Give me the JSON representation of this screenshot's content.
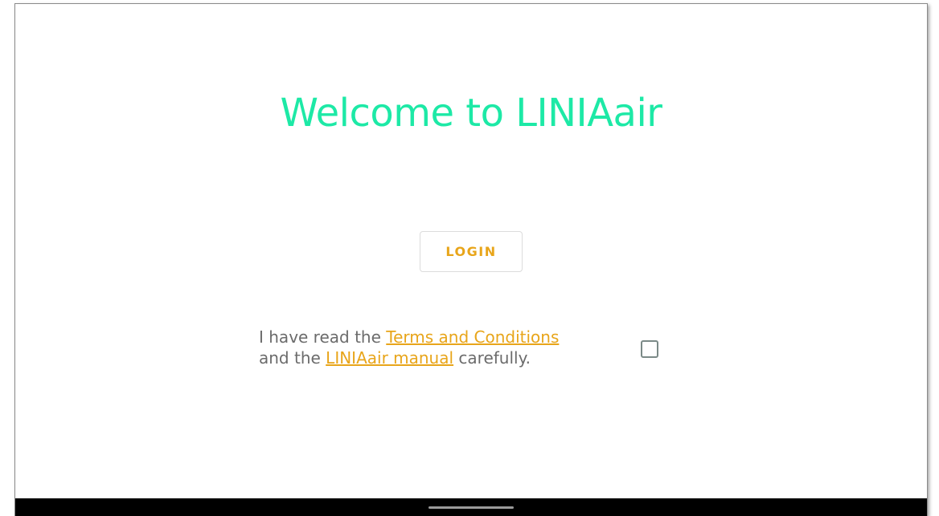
{
  "welcome": {
    "title": "Welcome to LINIAair"
  },
  "login": {
    "label": "LOGIN"
  },
  "agreement": {
    "text_prefix": "I have read the ",
    "terms_link": "Terms and Conditions",
    "text_middle": "and the ",
    "manual_link": "LINIAair manual",
    "text_suffix": " carefully.",
    "checked": false
  },
  "colors": {
    "title": "#1de9a6",
    "accent": "#e8a51a",
    "body_text": "#6b6b6b",
    "nav_bar": "#000000"
  }
}
